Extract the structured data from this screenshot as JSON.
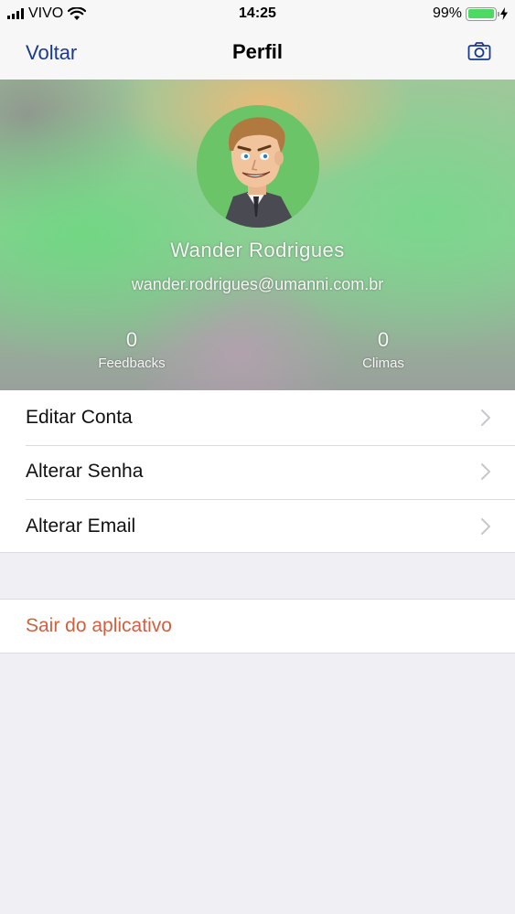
{
  "status_bar": {
    "carrier": "VIVO",
    "time": "14:25",
    "battery": "99%",
    "battery_level": 0.99,
    "icons": [
      "signal-icon",
      "wifi-icon",
      "battery-icon",
      "charging-bolt-icon"
    ]
  },
  "nav": {
    "back_label": "Voltar",
    "title": "Perfil",
    "right_icon": "camera-icon"
  },
  "profile": {
    "name": "Wander Rodrigues",
    "email": "wander.rodrigues@umanni.com.br",
    "stats": [
      {
        "value": "0",
        "label": "Feedbacks"
      },
      {
        "value": "0",
        "label": "Climas"
      }
    ]
  },
  "menu": {
    "items": [
      {
        "label": "Editar Conta"
      },
      {
        "label": "Alterar Senha"
      },
      {
        "label": "Alterar Email"
      }
    ]
  },
  "logout": {
    "label": "Sair do aplicativo"
  },
  "colors": {
    "nav_tint": "#1a3a8f",
    "destructive": "#d0603f",
    "background": "#efeff4",
    "battery_fill": "#4cd964"
  }
}
